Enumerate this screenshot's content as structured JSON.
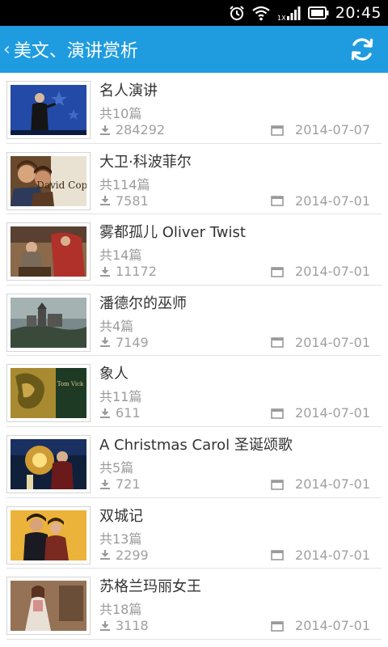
{
  "status_bar": {
    "time": "20:45",
    "signal_tag": "1X"
  },
  "header": {
    "back_chevron": "‹",
    "title": "美文、演讲赏析",
    "refresh_icon": "refresh-icon"
  },
  "colors": {
    "header_bg": "#1f9ce0",
    "status_bg": "#000000",
    "title_text": "#333333",
    "meta_text": "#a0a0a0",
    "divider": "#e2e2e2"
  },
  "items": [
    {
      "title": "名人演讲",
      "count": "共10篇",
      "downloads": "284292",
      "date": "2014-07-07"
    },
    {
      "title": "大卫·科波菲尔",
      "count": "共114篇",
      "downloads": "7581",
      "date": "2014-07-01"
    },
    {
      "title": "雾都孤儿 Oliver Twist",
      "count": "共14篇",
      "downloads": "11172",
      "date": "2014-07-01"
    },
    {
      "title": "潘德尔的巫师",
      "count": "共4篇",
      "downloads": "7149",
      "date": "2014-07-01"
    },
    {
      "title": "象人",
      "count": "共11篇",
      "downloads": "611",
      "date": "2014-07-01"
    },
    {
      "title": "A Christmas Carol 圣诞颂歌",
      "count": "共5篇",
      "downloads": "721",
      "date": "2014-07-01"
    },
    {
      "title": "双城记",
      "count": "共13篇",
      "downloads": "2299",
      "date": "2014-07-01"
    },
    {
      "title": "苏格兰玛丽女王",
      "count": "共18篇",
      "downloads": "3118",
      "date": "2014-07-01"
    }
  ],
  "covers": {
    "item1_text": "David Copper",
    "item4_text": "Tom Vick"
  }
}
